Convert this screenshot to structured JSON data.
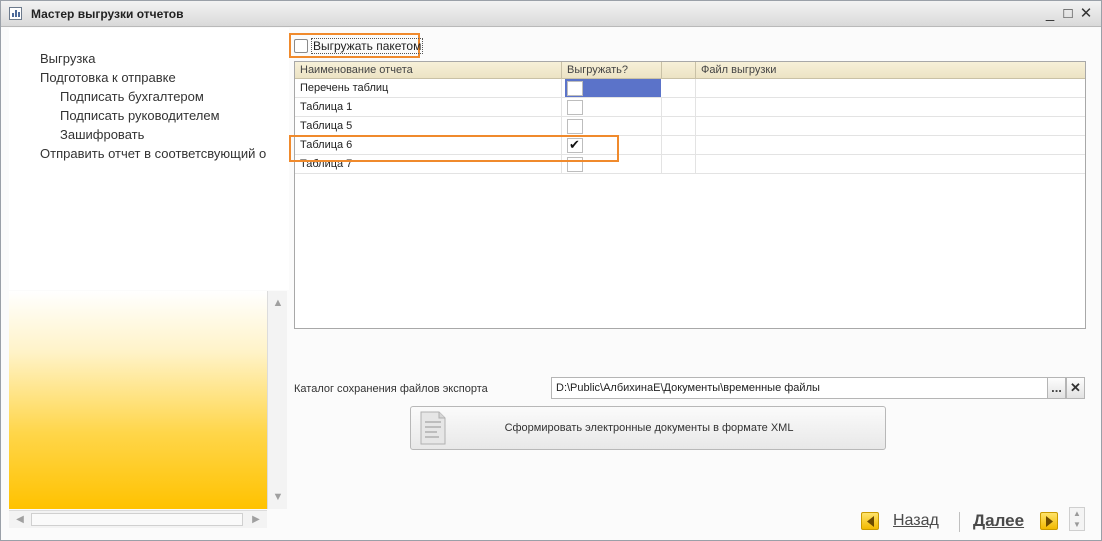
{
  "window": {
    "title": "Мастер выгрузки отчетов",
    "minimize": "_",
    "maximize": "□",
    "close": "✕"
  },
  "steps": [
    {
      "label": "Выгрузка",
      "level": 0
    },
    {
      "label": "Подготовка к отправке",
      "level": 0
    },
    {
      "label": "Подписать бухгалтером",
      "level": 1
    },
    {
      "label": "Подписать руководителем",
      "level": 1
    },
    {
      "label": "Зашифровать",
      "level": 1
    },
    {
      "label": "Отправить отчет в соответсвующий о",
      "level": 0
    }
  ],
  "batch": {
    "label": "Выгружать пакетом",
    "checked": false
  },
  "table": {
    "columns": [
      "Наименование отчета",
      "Выгружать?",
      "",
      "Файл выгрузки"
    ],
    "rows": [
      {
        "name": "Перечень таблиц",
        "export": false,
        "selected": true,
        "file": ""
      },
      {
        "name": "Таблица 1",
        "export": false,
        "selected": false,
        "file": ""
      },
      {
        "name": "Таблица 5",
        "export": false,
        "selected": false,
        "file": ""
      },
      {
        "name": "Таблица 6",
        "export": true,
        "selected": false,
        "file": ""
      },
      {
        "name": "Таблица 7",
        "export": false,
        "selected": false,
        "file": ""
      }
    ]
  },
  "export_folder": {
    "label": "Каталог сохранения файлов экспорта",
    "value": "D:\\Public\\АлбихинаЕ\\Документы\\временные файлы",
    "browse_label": "...",
    "clear_label": "✕"
  },
  "xml_button": {
    "label": "Сформировать электронные документы в формате XML"
  },
  "footer": {
    "back_label": "Назад",
    "next_label": "Далее"
  },
  "colors": {
    "highlight": "#f08a2c",
    "selection": "#5b73c9",
    "nav_arrow": "#f2b900"
  }
}
